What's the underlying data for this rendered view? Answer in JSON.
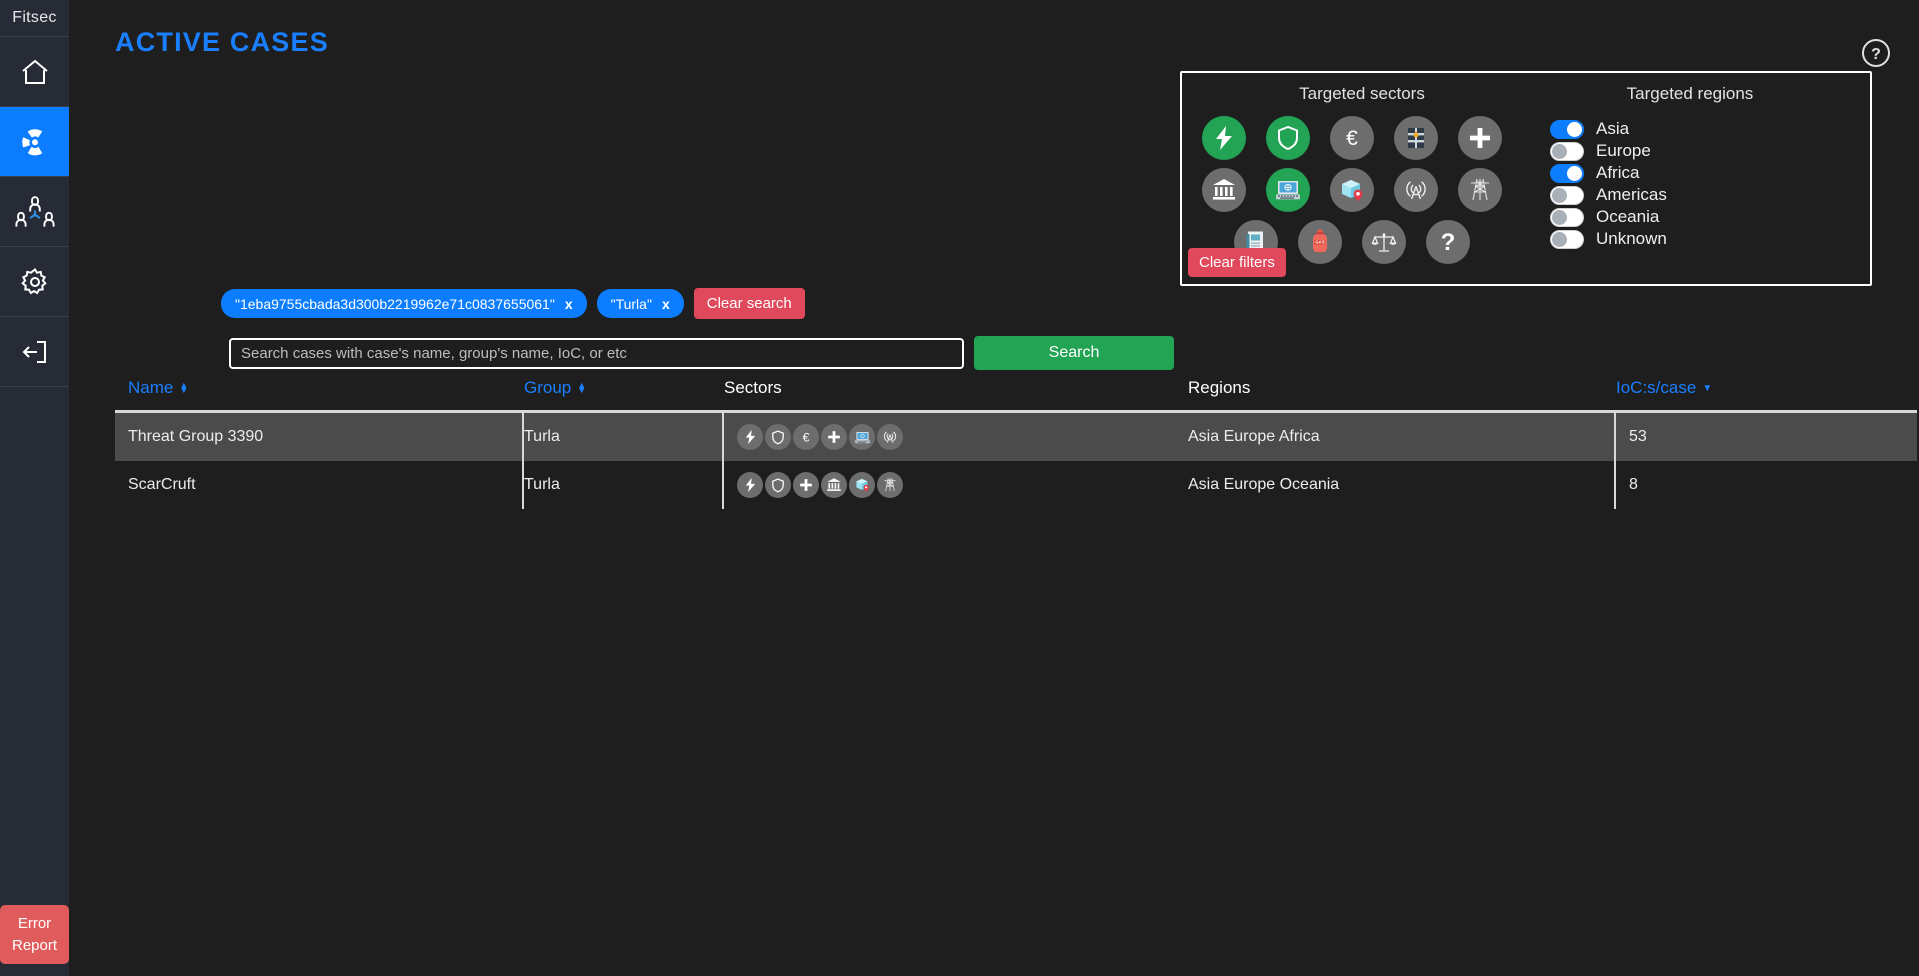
{
  "sidebar": {
    "brand": "Fitsec",
    "items": [
      {
        "name": "home",
        "icon": "home-icon",
        "active": false
      },
      {
        "name": "cases",
        "icon": "radiation-icon",
        "active": true
      },
      {
        "name": "groups",
        "icon": "people-network-icon",
        "active": false
      },
      {
        "name": "settings",
        "icon": "gear-icon",
        "active": false
      },
      {
        "name": "logout",
        "icon": "logout-icon",
        "active": false
      }
    ],
    "error_report_label": "Error\nReport",
    "error_report_line1": "Error",
    "error_report_line2": "Report"
  },
  "header": {
    "title": "ACTIVE CASES",
    "help_icon": "question-circle-icon"
  },
  "filters": {
    "sectors_title": "Targeted sectors",
    "regions_title": "Targeted regions",
    "clear_filters_label": "Clear filters",
    "sectors": [
      {
        "name": "energy",
        "icon": "lightning-icon",
        "active": true
      },
      {
        "name": "defense",
        "icon": "shield-icon",
        "active": true
      },
      {
        "name": "finance",
        "icon": "euro-icon",
        "active": false
      },
      {
        "name": "oil",
        "icon": "oil-barrel-icon",
        "active": false
      },
      {
        "name": "health",
        "icon": "medical-cross-icon",
        "active": false
      },
      {
        "name": "government",
        "icon": "bank-icon",
        "active": false
      },
      {
        "name": "it",
        "icon": "laptop-icon",
        "active": true
      },
      {
        "name": "logistics",
        "icon": "package-pin-icon",
        "active": false
      },
      {
        "name": "telecom",
        "icon": "antenna-icon",
        "active": false
      },
      {
        "name": "utilities",
        "icon": "power-pylon-icon",
        "active": false
      },
      {
        "name": "media",
        "icon": "newspaper-icon",
        "active": false
      },
      {
        "name": "gas",
        "icon": "gas-cylinder-icon",
        "active": false
      },
      {
        "name": "legal",
        "icon": "scales-icon",
        "active": false
      },
      {
        "name": "unknown",
        "icon": "question-mark-icon",
        "active": false
      }
    ],
    "regions": [
      {
        "label": "Asia",
        "on": true
      },
      {
        "label": "Europe",
        "on": false
      },
      {
        "label": "Africa",
        "on": true
      },
      {
        "label": "Americas",
        "on": false
      },
      {
        "label": "Oceania",
        "on": false
      },
      {
        "label": "Unknown",
        "on": false
      }
    ]
  },
  "search": {
    "tags": [
      {
        "text": "\"1eba9755cbada3d300b2219962e71c0837655061\"",
        "close": "x"
      },
      {
        "text": "\"Turla\"",
        "close": "x"
      }
    ],
    "clear_search_label": "Clear search",
    "placeholder": "Search cases with case's name, group's name, IoC, or etc",
    "value": "",
    "search_button_label": "Search"
  },
  "table": {
    "columns": [
      {
        "label": "Name",
        "sortable": true,
        "sort": "both"
      },
      {
        "label": "Group",
        "sortable": true,
        "sort": "both"
      },
      {
        "label": "Sectors",
        "sortable": false,
        "sort": "none"
      },
      {
        "label": "Regions",
        "sortable": false,
        "sort": "none"
      },
      {
        "label": "IoC:s/case",
        "sortable": true,
        "sort": "desc"
      }
    ],
    "rows": [
      {
        "name": "Threat Group 3390",
        "group": "Turla",
        "sectors": [
          "lightning-icon",
          "shield-icon",
          "euro-icon",
          "medical-cross-icon",
          "laptop-icon",
          "antenna-icon"
        ],
        "regions": "Asia Europe Africa",
        "iocs": "53",
        "highlighted": true
      },
      {
        "name": "ScarCruft",
        "group": "Turla",
        "sectors": [
          "lightning-icon",
          "shield-icon",
          "medical-cross-icon",
          "bank-icon",
          "package-pin-icon",
          "power-pylon-icon"
        ],
        "regions": "Asia Europe Oceania",
        "iocs": "8",
        "highlighted": false
      }
    ]
  },
  "colors": {
    "accent_blue": "#0d7dff",
    "title_blue": "#1a7fff",
    "green": "#23a455",
    "red": "#e0485c",
    "sidebar_bg": "#272b36",
    "page_bg": "#1e1e1e",
    "chip_gray": "#6d6d6d",
    "row_highlight": "#4b4b4b"
  }
}
